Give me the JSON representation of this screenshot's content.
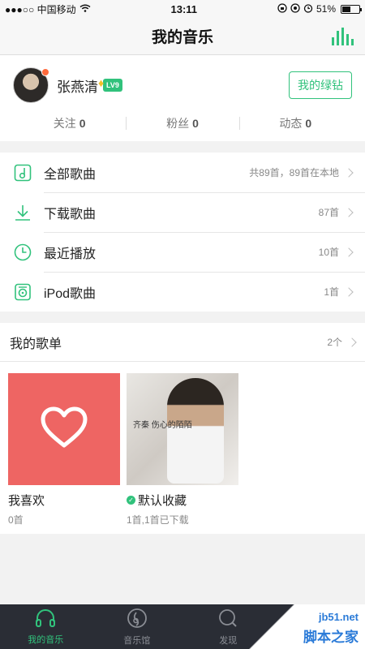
{
  "status_bar": {
    "carrier": "●●●○○ 中国移动",
    "time": "13:11",
    "battery": "51%",
    "battery_level": 0.51
  },
  "nav": {
    "title": "我的音乐"
  },
  "profile": {
    "name": "张燕清",
    "level_badge": "LV9",
    "green_diamond_button": "我的绿钻",
    "stats": [
      {
        "label": "关注",
        "value": "0"
      },
      {
        "label": "粉丝",
        "value": "0"
      },
      {
        "label": "动态",
        "value": "0"
      }
    ]
  },
  "music_list": [
    {
      "label": "全部歌曲",
      "count": "共89首，89首在本地",
      "icon": "music-file-icon"
    },
    {
      "label": "下载歌曲",
      "count": "87首",
      "icon": "download-icon"
    },
    {
      "label": "最近播放",
      "count": "10首",
      "icon": "clock-icon"
    },
    {
      "label": "iPod歌曲",
      "count": "1首",
      "icon": "ipod-icon"
    }
  ],
  "playlists": {
    "title": "我的歌单",
    "count": "2个",
    "items": [
      {
        "name": "我喜欢",
        "sub": "0首"
      },
      {
        "name": "默认收藏",
        "sub": "1首,1首已下载",
        "album_text": "齐秦 伤心的陌陌"
      }
    ]
  },
  "tabs": [
    {
      "label": "我的音乐",
      "icon": "headphones-icon",
      "active": true
    },
    {
      "label": "音乐馆",
      "icon": "music-hall-icon",
      "active": false
    },
    {
      "label": "发现",
      "icon": "discover-icon",
      "active": false
    }
  ],
  "watermark": {
    "line1": "jb51.net",
    "line2": "脚本之家"
  },
  "colors": {
    "accent": "#31c27c",
    "tab_bar": "#2a2d35",
    "favorite_cover": "#ee6563"
  }
}
